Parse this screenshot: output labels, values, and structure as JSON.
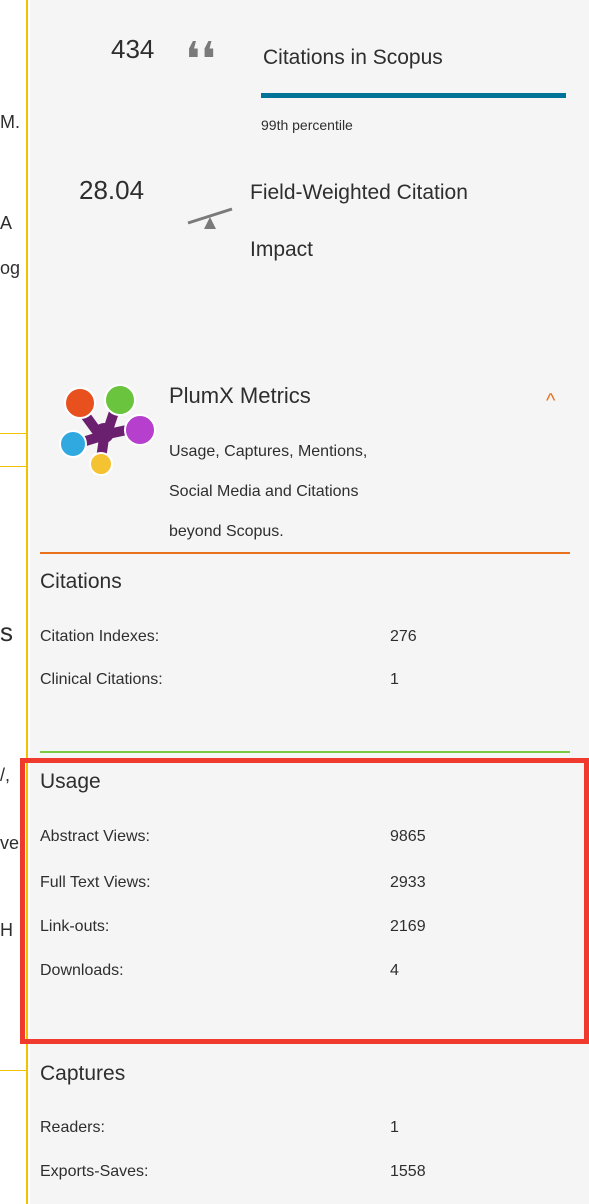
{
  "left_fragments": [
    "M.",
    "A",
    "og",
    "s",
    "/,",
    "ve",
    "H"
  ],
  "scopus": {
    "citations_count": "434",
    "citations_label": "Citations in Scopus",
    "percentile": "99th percentile",
    "quote_icon": "quote-icon",
    "fwci_value": "28.04",
    "fwci_label_line1": "Field-Weighted Citation",
    "fwci_label_line2": "Impact",
    "fwci_icon": "balance-scale-icon"
  },
  "plumx": {
    "title": "PlumX Metrics",
    "desc_line1": "Usage, Captures, Mentions,",
    "desc_line2": "Social Media and Citations",
    "desc_line3": "beyond Scopus.",
    "chevron": "^"
  },
  "sections": {
    "citations": {
      "title": "Citations",
      "rows": [
        {
          "label": "Citation Indexes:",
          "value": "276"
        },
        {
          "label": "Clinical Citations:",
          "value": "1"
        }
      ]
    },
    "usage": {
      "title": "Usage",
      "rows": [
        {
          "label": "Abstract Views:",
          "value": "9865"
        },
        {
          "label": "Full Text Views:",
          "value": "2933"
        },
        {
          "label": "Link-outs:",
          "value": "2169"
        },
        {
          "label": "Downloads:",
          "value": "4"
        }
      ]
    },
    "captures": {
      "title": "Captures",
      "rows": [
        {
          "label": "Readers:",
          "value": "1"
        },
        {
          "label": "Exports-Saves:",
          "value": "1558"
        }
      ]
    }
  },
  "colors": {
    "accent_teal": "#007398",
    "plum_orange": "#e9711c",
    "usage_green": "#7ac943",
    "highlight_red": "#f03a2e",
    "frame_yellow": "#f2c200"
  }
}
